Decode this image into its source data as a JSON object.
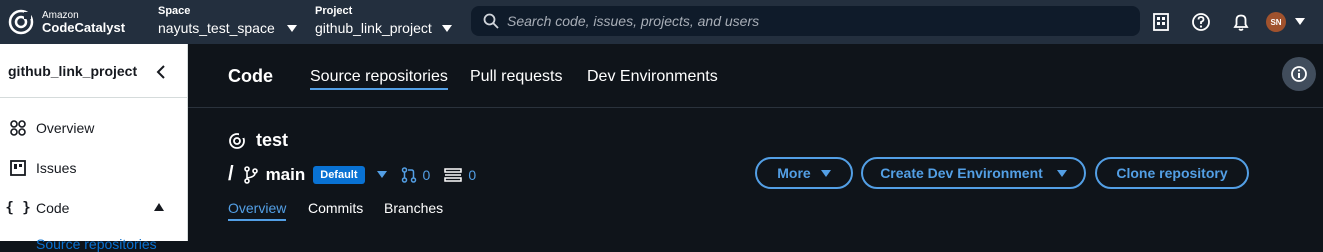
{
  "brand": {
    "line1": "Amazon",
    "line2": "CodeCatalyst"
  },
  "space": {
    "label": "Space",
    "value": "nayuts_test_space"
  },
  "project": {
    "label": "Project",
    "value": "github_link_project"
  },
  "search": {
    "placeholder": "Search code, issues, projects, and users"
  },
  "user": {
    "initials": "SN"
  },
  "sidebar": {
    "title": "github_link_project",
    "items": [
      {
        "label": "Overview",
        "icon": "overview-icon"
      },
      {
        "label": "Issues",
        "icon": "issues-icon"
      },
      {
        "label": "Code",
        "icon": "code-braces-icon"
      }
    ],
    "cut_item": "Source repositories"
  },
  "main": {
    "title": "Code",
    "tabs": [
      "Source repositories",
      "Pull requests",
      "Dev Environments"
    ],
    "repo": {
      "name": "test",
      "slash": "/",
      "branch": "main",
      "badge": "Default",
      "pull_requests": "0",
      "dev_envs": "0"
    },
    "buttons": {
      "more": "More",
      "create": "Create Dev Environment",
      "clone": "Clone repository"
    },
    "subtabs": [
      "Overview",
      "Commits",
      "Branches"
    ]
  },
  "colors": {
    "topbar": "#232f3e",
    "accent": "#539fe5",
    "badge": "#0972d3",
    "background": "#0f141a"
  }
}
